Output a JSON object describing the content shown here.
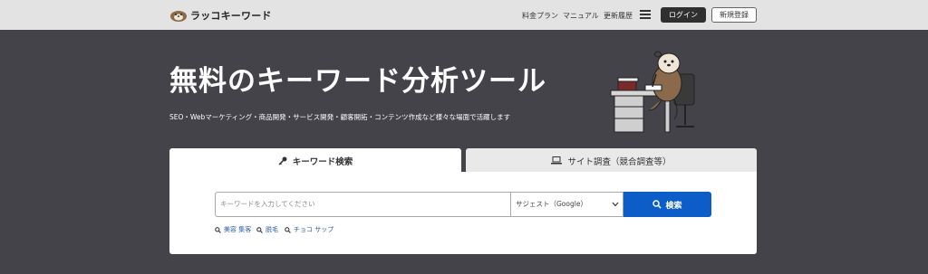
{
  "header": {
    "logo_text": "ラッコキーワード",
    "nav": [
      "料金プラン",
      "マニュアル",
      "更新履歴"
    ],
    "menu_icon": "hamburger-icon",
    "login_label": "ログイン",
    "signup_label": "新規登録"
  },
  "hero": {
    "title": "無料のキーワード分析ツール",
    "subtitle": "SEO・Webマーケティング・商品開発・サービス開発・顧客開拓・コンテンツ作成など様々な場面で活躍します"
  },
  "tabs": [
    {
      "label": "キーワード検索",
      "icon": "key-icon",
      "active": true
    },
    {
      "label": "サイト調査（競合調査等）",
      "icon": "laptop-icon",
      "active": false
    }
  ],
  "search": {
    "placeholder": "キーワードを入力してください",
    "value": "",
    "engine_selected": "サジェスト（Google）",
    "button_label": "検索",
    "button_icon": "search-icon"
  },
  "suggestions": [
    "美容 集客",
    "脱毛",
    "チョコ サップ"
  ],
  "colors": {
    "hero_bg": "#45434a",
    "topbar_bg": "#e3e3e3",
    "primary_blue": "#0d5dc9",
    "login_bg": "#2f2f2f",
    "link_blue": "#2b5aa8"
  }
}
